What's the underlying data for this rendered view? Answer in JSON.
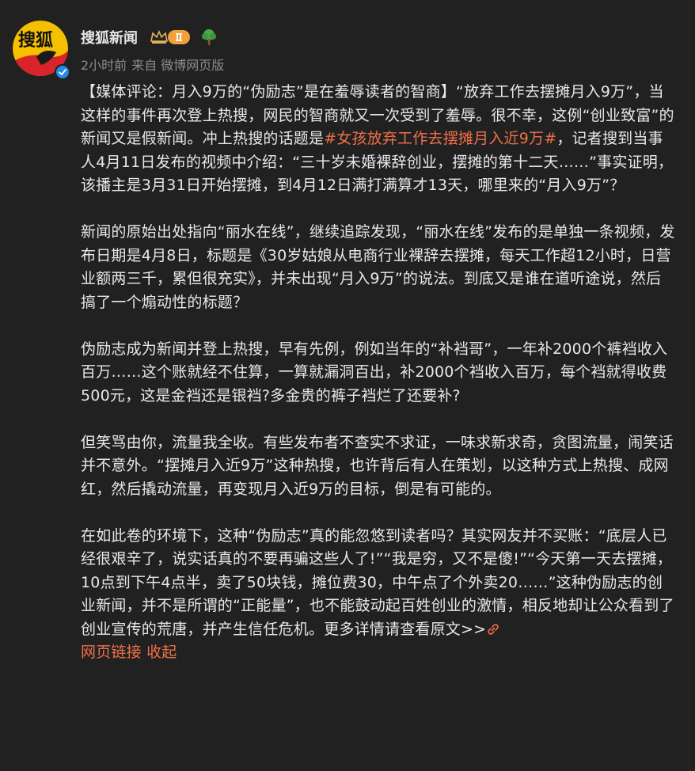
{
  "colors": {
    "background": "#212121",
    "text": "#e8e8e8",
    "meta": "#8c8c8c",
    "link": "#f07048",
    "verified": "#1e8ce8",
    "avatar_bg": "#f5c000",
    "avatar_red": "#d8242a"
  },
  "post": {
    "author": "搜狐新闻",
    "avatar_text": "搜狐",
    "icons": [
      "vip-crown-icon",
      "level-badge-icon",
      "tree-icon",
      "verified-icon",
      "link-icon"
    ],
    "time": "2小时前",
    "source": "来自 微博网页版",
    "p1_before": "【媒体评论：月入9万的“伪励志”是在羞辱读者的智商】“放弃工作去摆摊月入9万”，当这样的事件再次登上热搜，网民的智商就又一次受到了羞辱。很不幸，这例“创业致富”的新闻又是假新闻。冲上热搜的话题是",
    "hashtag": "#女孩放弃工作去摆摊月入近9万#",
    "p1_after": "，记者搜到当事人4月11日发布的视频中介绍：“三十岁未婚裸辞创业，摆摊的第十二天……”事实证明，该播主是3月31日开始摆摊，到4月12日满打满算才13天，哪里来的“月入9万”？",
    "p2": "新闻的原始出处指向“丽水在线”，继续追踪发现，“丽水在线”发布的是单独一条视频，发布日期是4月8日，标题是《30岁姑娘从电商行业裸辞去摆摊，每天工作超12小时，日营业额两三千，累但很充实》，并未出现“月入9万”的说法。到底又是谁在道听途说，然后搞了一个煽动性的标题？",
    "p3": "伪励志成为新闻并登上热搜，早有先例，例如当年的“补裆哥”，一年补2000个裤裆收入百万……这个账就经不住算，一算就漏洞百出，补2000个裆收入百万，每个裆就得收费500元，这是金裆还是银裆?多金贵的裤子裆烂了还要补?",
    "p4": "但笑骂由你，流量我全收。有些发布者不查实不求证，一味求新求奇，贪图流量，闹笑话并不意外。“摆摊月入近9万”这种热搜，也许背后有人在策划，以这种方式上热搜、成网红，然后撬动流量，再变现月入近9万的目标，倒是有可能的。",
    "p5": "在如此卷的环境下，这种“伪励志”真的能忽悠到读者吗？其实网友并不买账：“底层人已经很艰辛了，说实话真的不要再骗这些人了!”“我是穷，又不是傻!”“今天第一天去摆摊，10点到下午4点半，卖了50块钱，摊位费30，中午点了个外卖20……”这种伪励志的创业新闻，并不是所谓的“正能量”，也不能鼓动起百姓创业的激情，相反地却让公众看到了创业宣传的荒唐，并产生信任危机。更多详情请查看原文>>",
    "link_text": "网页链接",
    "collapse_text": "收起"
  }
}
